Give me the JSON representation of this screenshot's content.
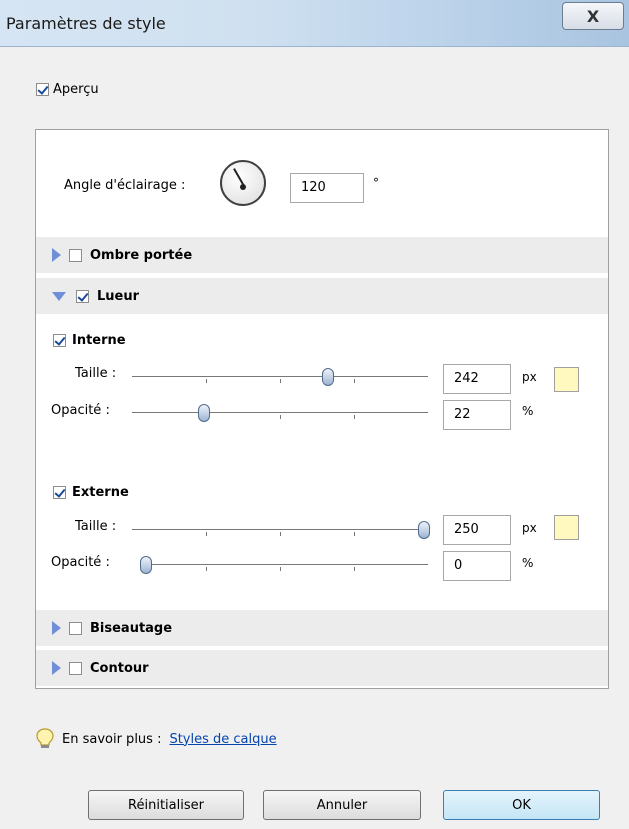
{
  "window": {
    "title": "Paramètres de style",
    "close": "X"
  },
  "apercu": {
    "label": "Aperçu",
    "checked": true
  },
  "lighting": {
    "label": "Angle d'éclairage :",
    "value": "120",
    "unit": "°"
  },
  "sections": {
    "ombre": {
      "label": "Ombre portée",
      "checked": false
    },
    "lueur": {
      "label": "Lueur",
      "checked": true
    },
    "biseautage": {
      "label": "Biseautage",
      "checked": false
    },
    "contour": {
      "label": "Contour",
      "checked": false
    }
  },
  "interne": {
    "label": "Interne",
    "checked": true,
    "taille_label": "Taille :",
    "taille_value": "242",
    "taille_unit": "px",
    "opacite_label": "Opacité :",
    "opacite_value": "22",
    "opacite_unit": "%",
    "color": "#fff9bf"
  },
  "externe": {
    "label": "Externe",
    "checked": true,
    "taille_label": "Taille :",
    "taille_value": "250",
    "taille_unit": "px",
    "opacite_label": "Opacité :",
    "opacite_value": "0",
    "opacite_unit": "%",
    "color": "#fff9bf"
  },
  "info": {
    "prefix": "En savoir plus :",
    "link": "Styles de calque",
    "icon": "lightbulb-icon"
  },
  "buttons": {
    "reset": "Réinitialiser",
    "cancel": "Annuler",
    "ok": "OK"
  }
}
